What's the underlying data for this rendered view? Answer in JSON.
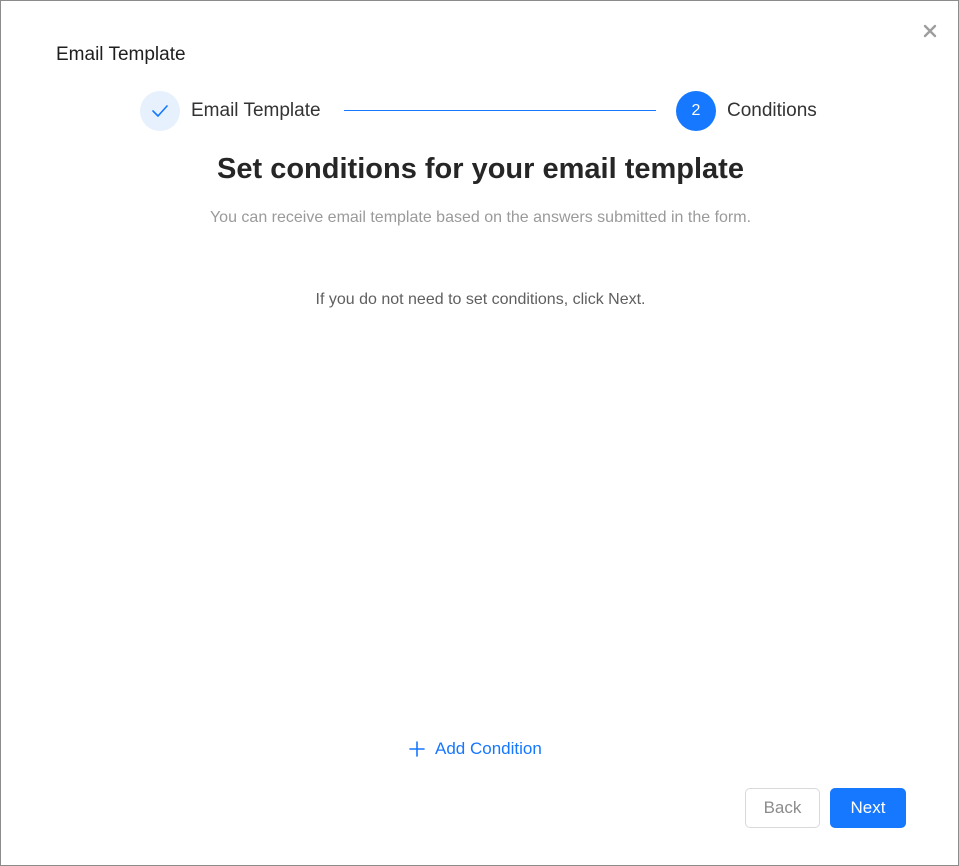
{
  "dialog": {
    "title": "Email Template",
    "close_icon": "close-icon"
  },
  "steps": [
    {
      "label": "Email Template",
      "status": "done",
      "icon": "check-icon"
    },
    {
      "label": "Conditions",
      "status": "active",
      "number": "2"
    }
  ],
  "content": {
    "heading": "Set conditions for your email template",
    "subtitle": "You can receive email template based on the answers submitted in the form.",
    "hint": "If you do not need to set conditions, click Next."
  },
  "add_condition": {
    "label": "Add Condition",
    "icon": "plus-icon"
  },
  "footer": {
    "back_label": "Back",
    "next_label": "Next"
  },
  "colors": {
    "primary": "#1677ff",
    "step_done_bg": "#e6f1fd",
    "subtitle": "#9a9a9a"
  }
}
